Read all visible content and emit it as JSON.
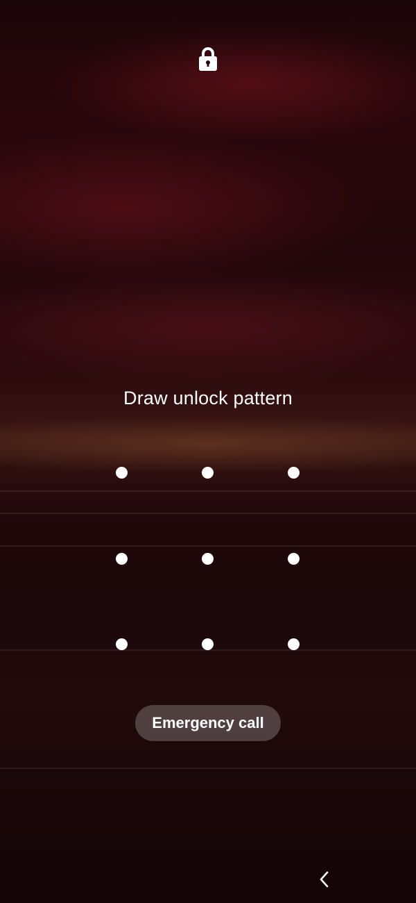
{
  "lock_screen": {
    "lock_icon": "lock-icon",
    "prompt": "Draw unlock pattern",
    "pattern": {
      "dot_count": 9,
      "rows": 3,
      "cols": 3
    },
    "emergency_call_label": "Emergency call"
  },
  "nav": {
    "back_icon": "chevron-left-icon"
  },
  "colors": {
    "text": "#ffffff",
    "button_bg": "rgba(255,255,255,0.22)",
    "wallpaper_tint": "#2a070c"
  }
}
